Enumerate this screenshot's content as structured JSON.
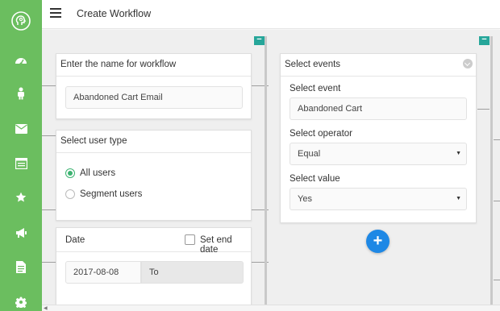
{
  "header": {
    "title": "Create Workflow"
  },
  "sidebar": {
    "icons": [
      "profile-head-icon",
      "dashboard-icon",
      "user-icon",
      "mail-icon",
      "calendar-icon",
      "star-icon",
      "megaphone-icon",
      "document-icon",
      "settings-icon"
    ]
  },
  "workflow_name_card": {
    "title": "Enter the name for workflow",
    "value": "Abandoned Cart Email"
  },
  "user_type_card": {
    "title": "Select user type",
    "options": [
      {
        "label": "All users",
        "selected": true
      },
      {
        "label": "Segment users",
        "selected": false
      }
    ]
  },
  "date_card": {
    "title": "Date",
    "end_date_label": "Set end date",
    "end_date_checked": false,
    "start_date": "2017-08-08",
    "to_label": "To"
  },
  "events_card": {
    "title": "Select events",
    "event_label": "Select event",
    "event_value": "Abandoned Cart",
    "operator_label": "Select operator",
    "operator_value": "Equal",
    "value_label": "Select value",
    "value_value": "Yes"
  },
  "collapse_symbol": "−",
  "add_symbol": "+",
  "caret_symbol": "▼",
  "colors": {
    "sidebar": "#6bbe5f",
    "collapse": "#26a69a",
    "add": "#1e88e5",
    "radio": "#3cb371"
  }
}
